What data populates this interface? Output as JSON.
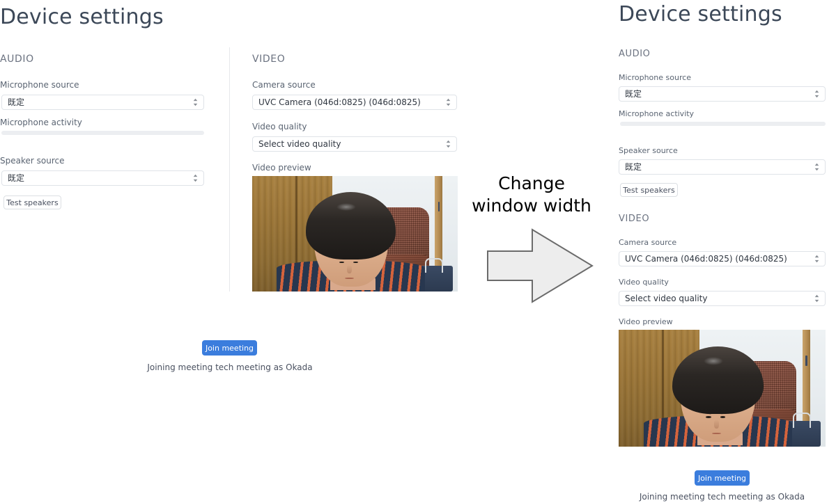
{
  "page": {
    "title": "Device settings"
  },
  "annotation": {
    "line1": "Change",
    "line2": "window width",
    "arrow_icon": "arrow-right-icon",
    "arrow_fill": "#ededed",
    "arrow_stroke": "#6b6b6b"
  },
  "colors": {
    "title": "#3c4858",
    "section_head": "#6b7280",
    "label": "#5a6472",
    "value": "#2f3640",
    "border": "#dfe3e8",
    "primary": "#3b7ddd",
    "meter_track": "#eceef1",
    "divider": "#e6e8eb"
  },
  "wide_layout": {
    "title": "Device settings",
    "audio": {
      "section_label": "AUDIO",
      "microphone_source": {
        "label": "Microphone source",
        "value": "既定",
        "icon": "select-chevrons-icon"
      },
      "microphone_activity": {
        "label": "Microphone activity",
        "level_percent": 0
      },
      "speaker_source": {
        "label": "Speaker source",
        "value": "既定",
        "icon": "select-chevrons-icon"
      },
      "test_speakers_label": "Test speakers"
    },
    "video": {
      "section_label": "VIDEO",
      "camera_source": {
        "label": "Camera source",
        "value": "UVC Camera (046d:0825) (046d:0825)",
        "icon": "select-chevrons-icon"
      },
      "video_quality": {
        "label": "Video quality",
        "value": "Select video quality",
        "icon": "select-chevrons-icon"
      },
      "video_preview": {
        "label": "Video preview",
        "icon": "webcam-preview-icon"
      }
    },
    "join_button_label": "Join meeting",
    "status_text": "Joining meeting tech meeting as Okada"
  },
  "narrow_layout": {
    "title": "Device settings",
    "audio": {
      "section_label": "AUDIO",
      "microphone_source": {
        "label": "Microphone source",
        "value": "既定",
        "icon": "select-chevrons-icon"
      },
      "microphone_activity": {
        "label": "Microphone activity",
        "level_percent": 0
      },
      "speaker_source": {
        "label": "Speaker source",
        "value": "既定",
        "icon": "select-chevrons-icon"
      },
      "test_speakers_label": "Test speakers"
    },
    "video": {
      "section_label": "VIDEO",
      "camera_source": {
        "label": "Camera source",
        "value": "UVC Camera (046d:0825) (046d:0825)",
        "icon": "select-chevrons-icon"
      },
      "video_quality": {
        "label": "Video quality",
        "value": "Select video quality",
        "icon": "select-chevrons-icon"
      },
      "video_preview": {
        "label": "Video preview",
        "icon": "webcam-preview-icon"
      }
    },
    "join_button_label": "Join meeting",
    "status_text": "Joining meeting tech meeting as Okada"
  }
}
